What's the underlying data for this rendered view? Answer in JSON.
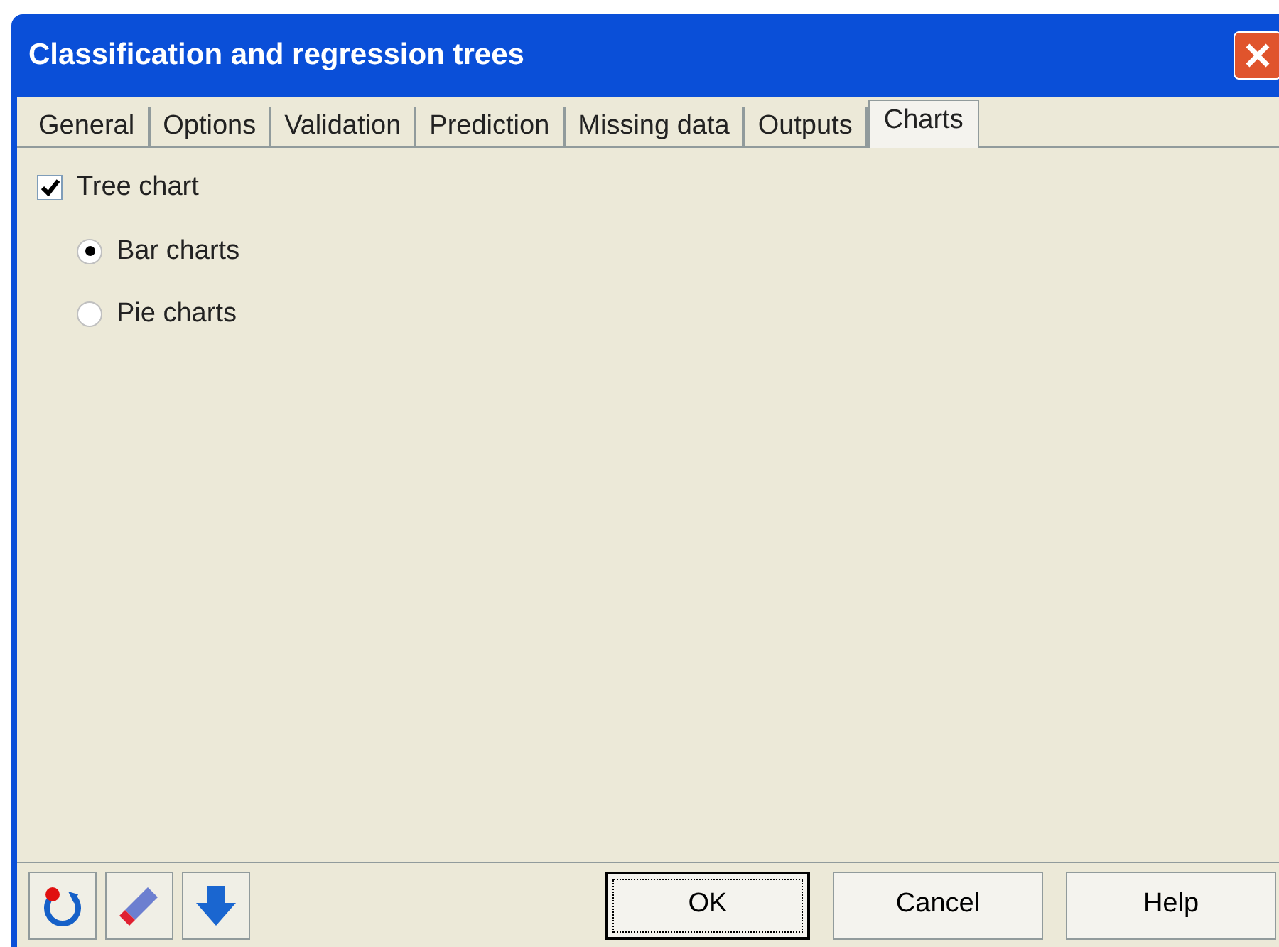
{
  "window": {
    "title": "Classification and regression trees"
  },
  "tabs": [
    {
      "label": "General",
      "selected": false
    },
    {
      "label": "Options",
      "selected": false
    },
    {
      "label": "Validation",
      "selected": false
    },
    {
      "label": "Prediction",
      "selected": false
    },
    {
      "label": "Missing data",
      "selected": false
    },
    {
      "label": "Outputs",
      "selected": false
    },
    {
      "label": "Charts",
      "selected": true
    }
  ],
  "tree_chart": {
    "label": "Tree chart",
    "checked": true
  },
  "chart_type": [
    {
      "label": "Bar charts",
      "selected": true
    },
    {
      "label": "Pie charts",
      "selected": false
    }
  ],
  "buttons": [
    "OK",
    "Cancel",
    "Help"
  ]
}
